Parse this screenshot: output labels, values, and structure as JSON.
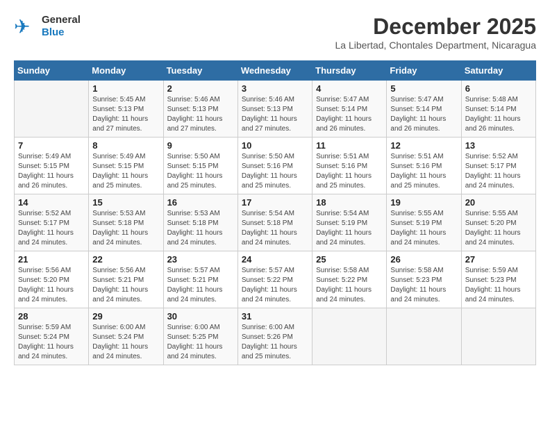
{
  "header": {
    "logo_general": "General",
    "logo_blue": "Blue",
    "month_title": "December 2025",
    "subtitle": "La Libertad, Chontales Department, Nicaragua"
  },
  "weekdays": [
    "Sunday",
    "Monday",
    "Tuesday",
    "Wednesday",
    "Thursday",
    "Friday",
    "Saturday"
  ],
  "weeks": [
    [
      {
        "day": "",
        "sunrise": "",
        "sunset": "",
        "daylight": ""
      },
      {
        "day": "1",
        "sunrise": "Sunrise: 5:45 AM",
        "sunset": "Sunset: 5:13 PM",
        "daylight": "Daylight: 11 hours and 27 minutes."
      },
      {
        "day": "2",
        "sunrise": "Sunrise: 5:46 AM",
        "sunset": "Sunset: 5:13 PM",
        "daylight": "Daylight: 11 hours and 27 minutes."
      },
      {
        "day": "3",
        "sunrise": "Sunrise: 5:46 AM",
        "sunset": "Sunset: 5:13 PM",
        "daylight": "Daylight: 11 hours and 27 minutes."
      },
      {
        "day": "4",
        "sunrise": "Sunrise: 5:47 AM",
        "sunset": "Sunset: 5:14 PM",
        "daylight": "Daylight: 11 hours and 26 minutes."
      },
      {
        "day": "5",
        "sunrise": "Sunrise: 5:47 AM",
        "sunset": "Sunset: 5:14 PM",
        "daylight": "Daylight: 11 hours and 26 minutes."
      },
      {
        "day": "6",
        "sunrise": "Sunrise: 5:48 AM",
        "sunset": "Sunset: 5:14 PM",
        "daylight": "Daylight: 11 hours and 26 minutes."
      }
    ],
    [
      {
        "day": "7",
        "sunrise": "Sunrise: 5:49 AM",
        "sunset": "Sunset: 5:15 PM",
        "daylight": "Daylight: 11 hours and 26 minutes."
      },
      {
        "day": "8",
        "sunrise": "Sunrise: 5:49 AM",
        "sunset": "Sunset: 5:15 PM",
        "daylight": "Daylight: 11 hours and 25 minutes."
      },
      {
        "day": "9",
        "sunrise": "Sunrise: 5:50 AM",
        "sunset": "Sunset: 5:15 PM",
        "daylight": "Daylight: 11 hours and 25 minutes."
      },
      {
        "day": "10",
        "sunrise": "Sunrise: 5:50 AM",
        "sunset": "Sunset: 5:16 PM",
        "daylight": "Daylight: 11 hours and 25 minutes."
      },
      {
        "day": "11",
        "sunrise": "Sunrise: 5:51 AM",
        "sunset": "Sunset: 5:16 PM",
        "daylight": "Daylight: 11 hours and 25 minutes."
      },
      {
        "day": "12",
        "sunrise": "Sunrise: 5:51 AM",
        "sunset": "Sunset: 5:16 PM",
        "daylight": "Daylight: 11 hours and 25 minutes."
      },
      {
        "day": "13",
        "sunrise": "Sunrise: 5:52 AM",
        "sunset": "Sunset: 5:17 PM",
        "daylight": "Daylight: 11 hours and 24 minutes."
      }
    ],
    [
      {
        "day": "14",
        "sunrise": "Sunrise: 5:52 AM",
        "sunset": "Sunset: 5:17 PM",
        "daylight": "Daylight: 11 hours and 24 minutes."
      },
      {
        "day": "15",
        "sunrise": "Sunrise: 5:53 AM",
        "sunset": "Sunset: 5:18 PM",
        "daylight": "Daylight: 11 hours and 24 minutes."
      },
      {
        "day": "16",
        "sunrise": "Sunrise: 5:53 AM",
        "sunset": "Sunset: 5:18 PM",
        "daylight": "Daylight: 11 hours and 24 minutes."
      },
      {
        "day": "17",
        "sunrise": "Sunrise: 5:54 AM",
        "sunset": "Sunset: 5:18 PM",
        "daylight": "Daylight: 11 hours and 24 minutes."
      },
      {
        "day": "18",
        "sunrise": "Sunrise: 5:54 AM",
        "sunset": "Sunset: 5:19 PM",
        "daylight": "Daylight: 11 hours and 24 minutes."
      },
      {
        "day": "19",
        "sunrise": "Sunrise: 5:55 AM",
        "sunset": "Sunset: 5:19 PM",
        "daylight": "Daylight: 11 hours and 24 minutes."
      },
      {
        "day": "20",
        "sunrise": "Sunrise: 5:55 AM",
        "sunset": "Sunset: 5:20 PM",
        "daylight": "Daylight: 11 hours and 24 minutes."
      }
    ],
    [
      {
        "day": "21",
        "sunrise": "Sunrise: 5:56 AM",
        "sunset": "Sunset: 5:20 PM",
        "daylight": "Daylight: 11 hours and 24 minutes."
      },
      {
        "day": "22",
        "sunrise": "Sunrise: 5:56 AM",
        "sunset": "Sunset: 5:21 PM",
        "daylight": "Daylight: 11 hours and 24 minutes."
      },
      {
        "day": "23",
        "sunrise": "Sunrise: 5:57 AM",
        "sunset": "Sunset: 5:21 PM",
        "daylight": "Daylight: 11 hours and 24 minutes."
      },
      {
        "day": "24",
        "sunrise": "Sunrise: 5:57 AM",
        "sunset": "Sunset: 5:22 PM",
        "daylight": "Daylight: 11 hours and 24 minutes."
      },
      {
        "day": "25",
        "sunrise": "Sunrise: 5:58 AM",
        "sunset": "Sunset: 5:22 PM",
        "daylight": "Daylight: 11 hours and 24 minutes."
      },
      {
        "day": "26",
        "sunrise": "Sunrise: 5:58 AM",
        "sunset": "Sunset: 5:23 PM",
        "daylight": "Daylight: 11 hours and 24 minutes."
      },
      {
        "day": "27",
        "sunrise": "Sunrise: 5:59 AM",
        "sunset": "Sunset: 5:23 PM",
        "daylight": "Daylight: 11 hours and 24 minutes."
      }
    ],
    [
      {
        "day": "28",
        "sunrise": "Sunrise: 5:59 AM",
        "sunset": "Sunset: 5:24 PM",
        "daylight": "Daylight: 11 hours and 24 minutes."
      },
      {
        "day": "29",
        "sunrise": "Sunrise: 6:00 AM",
        "sunset": "Sunset: 5:24 PM",
        "daylight": "Daylight: 11 hours and 24 minutes."
      },
      {
        "day": "30",
        "sunrise": "Sunrise: 6:00 AM",
        "sunset": "Sunset: 5:25 PM",
        "daylight": "Daylight: 11 hours and 24 minutes."
      },
      {
        "day": "31",
        "sunrise": "Sunrise: 6:00 AM",
        "sunset": "Sunset: 5:26 PM",
        "daylight": "Daylight: 11 hours and 25 minutes."
      },
      {
        "day": "",
        "sunrise": "",
        "sunset": "",
        "daylight": ""
      },
      {
        "day": "",
        "sunrise": "",
        "sunset": "",
        "daylight": ""
      },
      {
        "day": "",
        "sunrise": "",
        "sunset": "",
        "daylight": ""
      }
    ]
  ]
}
